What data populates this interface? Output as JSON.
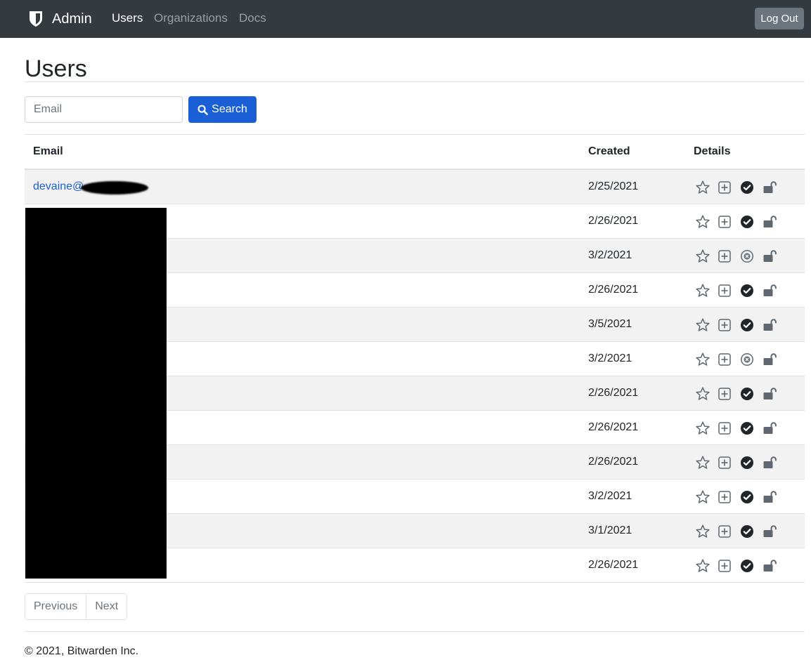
{
  "navbar": {
    "brand": "Admin",
    "links": [
      {
        "label": "Users",
        "active": true
      },
      {
        "label": "Organizations",
        "active": false
      },
      {
        "label": "Docs",
        "active": false
      }
    ],
    "logout_label": "Log Out"
  },
  "page": {
    "title": "Users"
  },
  "search": {
    "placeholder": "Email",
    "value": "",
    "button_label": "Search"
  },
  "table": {
    "headers": {
      "email": "Email",
      "created": "Created",
      "details": "Details"
    },
    "rows": [
      {
        "email": "devaine@",
        "created": "2/25/2021",
        "verified": true
      },
      {
        "email": "",
        "created": "2/26/2021",
        "verified": true
      },
      {
        "email": "",
        "created": "3/2/2021",
        "verified": false
      },
      {
        "email": "",
        "created": "2/26/2021",
        "verified": true
      },
      {
        "email": "",
        "created": "3/5/2021",
        "verified": true
      },
      {
        "email": "",
        "created": "3/2/2021",
        "verified": false
      },
      {
        "email": "",
        "created": "2/26/2021",
        "verified": true
      },
      {
        "email": "",
        "created": "2/26/2021",
        "verified": true
      },
      {
        "email": "",
        "created": "2/26/2021",
        "verified": true
      },
      {
        "email": "",
        "created": "3/2/2021",
        "verified": true
      },
      {
        "email": "",
        "created": "3/1/2021",
        "verified": true
      },
      {
        "email": "",
        "created": "2/26/2021",
        "verified": true
      }
    ],
    "detail_icons": [
      "star-icon",
      "plus-square-icon",
      "check-circle-icon",
      "unlock-icon"
    ]
  },
  "pagination": {
    "previous_label": "Previous",
    "next_label": "Next"
  },
  "footer": {
    "text": "© 2021, Bitwarden Inc."
  },
  "colors": {
    "navbar": "#343a40",
    "primary": "#1a5fd6",
    "secondary": "#6c757d",
    "stripe": "#f2f2f2",
    "border": "#dee2e6"
  }
}
